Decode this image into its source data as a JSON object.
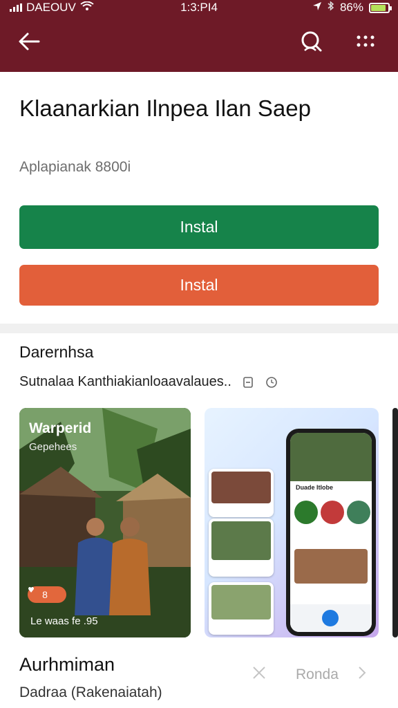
{
  "status_bar": {
    "carrier": "DAEOUV",
    "time": "1:3:PI4",
    "battery": "86%",
    "battery_level": 0.86,
    "icons": [
      "signal-icon",
      "wifi-icon",
      "location-icon",
      "bluetooth-icon",
      "battery-icon"
    ]
  },
  "app_bar": {
    "background": "#6e1a27",
    "icons": [
      "back-arrow-icon",
      "search-icon",
      "more-dots-icon"
    ]
  },
  "app": {
    "title": "Klaanarkian Ilnpea Ilan Saep",
    "subtitle": "Aplapianak 8800i"
  },
  "buttons": {
    "primary_label": "Instal",
    "primary_color": "#16834a",
    "secondary_label": "Instal",
    "secondary_color": "#e25f3a"
  },
  "about": {
    "heading": "Darernhsa",
    "description": "Sutnalaa Kanthiakianloaavalaues..",
    "icons": [
      "copy-icon",
      "clock-icon"
    ]
  },
  "screenshots": {
    "first_title": "Warperid",
    "first_subtitle": "Gepehees",
    "first_badge": "8",
    "first_footer": "Le waas fe .95",
    "phone_label": "Duade Itlobe"
  },
  "footer": {
    "title": "Aurhmiman",
    "subtitle": "Dadraa (Rakenaiatah)",
    "nav_label": "Ronda",
    "icons": [
      "close-icon",
      "chevron-right-icon"
    ]
  }
}
